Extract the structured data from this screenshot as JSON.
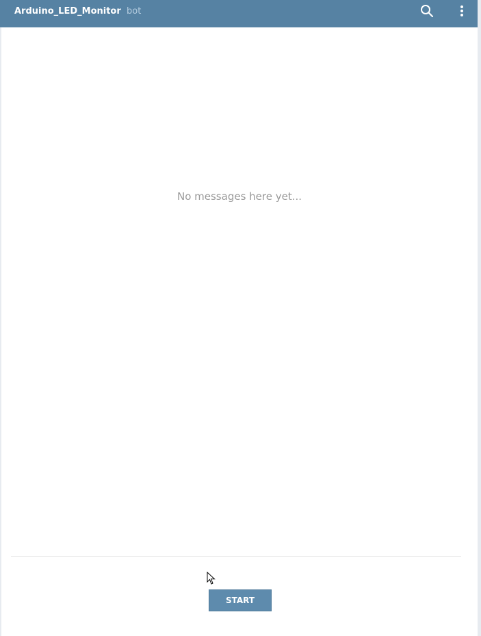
{
  "header": {
    "title": "Arduino_LED_Monitor",
    "subtitle": "bot",
    "search_icon": "search-icon",
    "more_icon": "more-vertical-icon",
    "background_color": "#5682a3"
  },
  "messages": {
    "empty_text": "No messages here yet..."
  },
  "footer": {
    "start_label": "START",
    "button_color": "#5e8bad"
  }
}
